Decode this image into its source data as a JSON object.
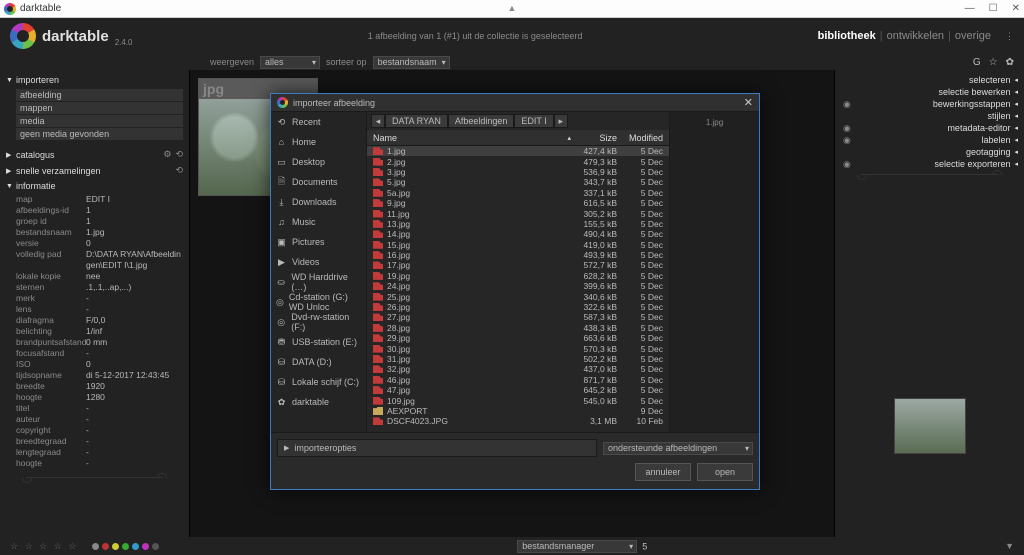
{
  "window": {
    "title": "darktable"
  },
  "brand": {
    "name": "darktable",
    "version": "2.4.0"
  },
  "header": {
    "status": "1 afbeelding van 1 (#1) uit de collectie is geselecteerd",
    "modes": {
      "lib": "bibliotheek",
      "dev": "ontwikkelen",
      "other": "overige"
    }
  },
  "toolbar": {
    "view_label": "weergeven",
    "view_value": "alles",
    "sort_label": "sorteer op",
    "sort_value": "bestandsnaam",
    "icons": {
      "g": "G",
      "star": "☆",
      "gear": "✿"
    }
  },
  "left_panel": {
    "import": {
      "title": "importeren",
      "items": [
        "afbeelding",
        "mappen",
        "media",
        "geen media gevonden"
      ]
    },
    "catalog": {
      "title": "catalogus"
    },
    "collections": {
      "title": "snelle verzamelingen"
    },
    "info": {
      "title": "informatie",
      "rows": [
        {
          "k": "map",
          "v": "EDIT I"
        },
        {
          "k": "afbeeldings-id",
          "v": "1"
        },
        {
          "k": "groep id",
          "v": "1"
        },
        {
          "k": "bestandsnaam",
          "v": "1.jpg"
        },
        {
          "k": "versie",
          "v": "0"
        },
        {
          "k": "volledig pad",
          "v": "D:\\DATA RYAN\\Afbeeldingen\\EDIT I\\1.jpg"
        },
        {
          "k": "lokale kopie",
          "v": "nee"
        },
        {
          "k": "sternen",
          "v": ".1,.1,..ap,...)"
        },
        {
          "k": "merk",
          "v": "-"
        },
        {
          "k": "lens",
          "v": "-"
        },
        {
          "k": "diafragma",
          "v": "F/0,0"
        },
        {
          "k": "belichting",
          "v": "1/inf"
        },
        {
          "k": "brandpuntsafstand",
          "v": "0 mm"
        },
        {
          "k": "focusafstand",
          "v": "-"
        },
        {
          "k": "ISO",
          "v": "0"
        },
        {
          "k": "tijdsopname",
          "v": "di 5-12-2017 12:43:45"
        },
        {
          "k": "breedte",
          "v": "1920"
        },
        {
          "k": "hoogte",
          "v": "1280"
        },
        {
          "k": "titel",
          "v": "-"
        },
        {
          "k": "auteur",
          "v": "-"
        },
        {
          "k": "copyright",
          "v": "-"
        },
        {
          "k": "breedtegraad",
          "v": "-"
        },
        {
          "k": "lengtegraad",
          "v": "-"
        },
        {
          "k": "hoogte",
          "v": "-"
        }
      ]
    }
  },
  "right_panel": {
    "rows": [
      {
        "label": "selecteren",
        "eye": false
      },
      {
        "label": "selectie bewerken",
        "eye": false
      },
      {
        "label": "bewerkingsstappen",
        "eye": true
      },
      {
        "label": "stijlen",
        "eye": false
      },
      {
        "label": "metadata-editor",
        "eye": true
      },
      {
        "label": "labelen",
        "eye": true
      },
      {
        "label": "geotagging",
        "eye": false
      },
      {
        "label": "selectie exporteren",
        "eye": true
      }
    ]
  },
  "thumb": {
    "ext": "jpg"
  },
  "bottom": {
    "stars": "☆ ☆ ☆ ☆ ☆",
    "dots": [
      "#888",
      "#b33",
      "#cc3",
      "#3a3",
      "#39c",
      "#b3b",
      "#555"
    ],
    "zoom": "5",
    "layout": "bestandsmanager"
  },
  "dialog": {
    "title": "importeer afbeelding",
    "places": [
      {
        "icon": "⟲",
        "label": "Recent"
      },
      {
        "icon": "⌂",
        "label": "Home"
      },
      {
        "icon": "▭",
        "label": "Desktop"
      },
      {
        "icon": "🗎",
        "label": "Documents"
      },
      {
        "icon": "⤓",
        "label": "Downloads"
      },
      {
        "icon": "♫",
        "label": "Music"
      },
      {
        "icon": "▣",
        "label": "Pictures"
      },
      {
        "icon": "▶",
        "label": "Videos"
      },
      {
        "icon": "⛀",
        "label": "WD Harddrive (…)"
      },
      {
        "icon": "◎",
        "label": "Cd-station (G:) WD Unloc"
      },
      {
        "icon": "◎",
        "label": "Dvd-rw-station (F:)"
      },
      {
        "icon": "⛃",
        "label": "USB-station (E:)"
      },
      {
        "icon": "⛁",
        "label": "DATA (D:)"
      },
      {
        "icon": "⛁",
        "label": "Lokale schijf (C:)"
      },
      {
        "icon": "✿",
        "label": "darktable"
      }
    ],
    "crumbs": [
      "DATA RYAN",
      "Afbeeldingen",
      "EDIT I"
    ],
    "preview_name": "1.jpg",
    "headers": {
      "name": "Name",
      "size": "Size",
      "mod": "Modified"
    },
    "files": [
      {
        "n": "1.jpg",
        "s": "427,4 kB",
        "m": "5 Dec",
        "sel": true
      },
      {
        "n": "2.jpg",
        "s": "479,3 kB",
        "m": "5 Dec"
      },
      {
        "n": "3.jpg",
        "s": "536,9 kB",
        "m": "5 Dec"
      },
      {
        "n": "5.jpg",
        "s": "343,7 kB",
        "m": "5 Dec"
      },
      {
        "n": "5a.jpg",
        "s": "337,1 kB",
        "m": "5 Dec"
      },
      {
        "n": "9.jpg",
        "s": "616,5 kB",
        "m": "5 Dec"
      },
      {
        "n": "11.jpg",
        "s": "305,2 kB",
        "m": "5 Dec"
      },
      {
        "n": "13.jpg",
        "s": "155,5 kB",
        "m": "5 Dec"
      },
      {
        "n": "14.jpg",
        "s": "490,4 kB",
        "m": "5 Dec"
      },
      {
        "n": "15.jpg",
        "s": "419,0 kB",
        "m": "5 Dec"
      },
      {
        "n": "16.jpg",
        "s": "493,9 kB",
        "m": "5 Dec"
      },
      {
        "n": "17.jpg",
        "s": "572,7 kB",
        "m": "5 Dec"
      },
      {
        "n": "19.jpg",
        "s": "628,2 kB",
        "m": "5 Dec"
      },
      {
        "n": "24.jpg",
        "s": "399,6 kB",
        "m": "5 Dec"
      },
      {
        "n": "25.jpg",
        "s": "340,6 kB",
        "m": "5 Dec"
      },
      {
        "n": "26.jpg",
        "s": "322,6 kB",
        "m": "5 Dec"
      },
      {
        "n": "27.jpg",
        "s": "587,3 kB",
        "m": "5 Dec"
      },
      {
        "n": "28.jpg",
        "s": "438,3 kB",
        "m": "5 Dec"
      },
      {
        "n": "29.jpg",
        "s": "663,6 kB",
        "m": "5 Dec"
      },
      {
        "n": "30.jpg",
        "s": "570,3 kB",
        "m": "5 Dec"
      },
      {
        "n": "31.jpg",
        "s": "502,2 kB",
        "m": "5 Dec"
      },
      {
        "n": "32.jpg",
        "s": "437,0 kB",
        "m": "5 Dec"
      },
      {
        "n": "46.jpg",
        "s": "871,7 kB",
        "m": "5 Dec"
      },
      {
        "n": "47.jpg",
        "s": "645,2 kB",
        "m": "5 Dec"
      },
      {
        "n": "109.jpg",
        "s": "545,0 kB",
        "m": "5 Dec"
      },
      {
        "n": "AEXPORT",
        "s": "",
        "m": "9 Dec",
        "folder": true
      },
      {
        "n": "DSCF4023.JPG",
        "s": "3,1 MB",
        "m": "10 Feb"
      }
    ],
    "options_label": "importeeropties",
    "filter": "ondersteunde afbeeldingen",
    "btn_cancel": "annuleer",
    "btn_open": "open"
  }
}
